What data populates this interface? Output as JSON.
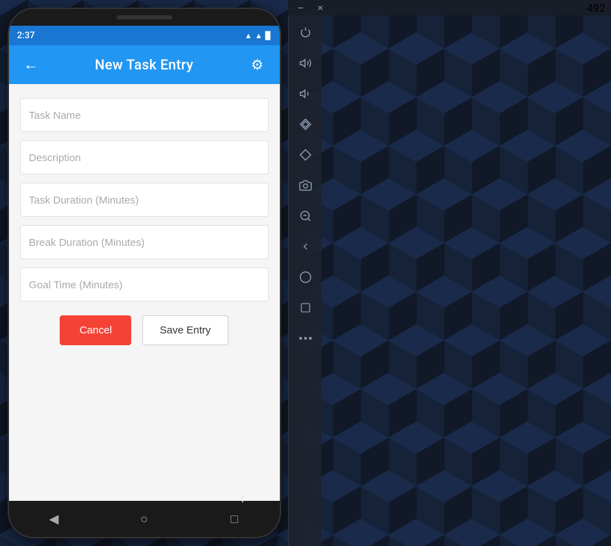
{
  "status_bar": {
    "time": "2:37",
    "icons": [
      "●",
      "▲",
      "▉"
    ]
  },
  "header": {
    "back_label": "←",
    "title": "New Task Entry",
    "settings_label": "⚙"
  },
  "form": {
    "fields": [
      {
        "placeholder": "Task Name",
        "value": ""
      },
      {
        "placeholder": "Description",
        "value": ""
      },
      {
        "placeholder": "Task Duration (Minutes)",
        "value": ""
      },
      {
        "placeholder": "Break Duration (Minutes)",
        "value": ""
      },
      {
        "placeholder": "Goal Time (Minutes)",
        "value": ""
      }
    ],
    "cancel_label": "Cancel",
    "save_label": "Save Entry"
  },
  "nav": {
    "back": "◀",
    "home": "○",
    "recents": "□"
  },
  "window": {
    "minimize": "−",
    "close": "×",
    "counter": "492"
  },
  "toolbar": {
    "items": [
      {
        "name": "power-icon",
        "glyph": "⏻"
      },
      {
        "name": "volume-up-icon",
        "glyph": "🔊"
      },
      {
        "name": "volume-down-icon",
        "glyph": "🔉"
      },
      {
        "name": "diamond1-icon",
        "glyph": "◈"
      },
      {
        "name": "diamond2-icon",
        "glyph": "◇"
      },
      {
        "name": "camera-icon",
        "glyph": "⊙"
      },
      {
        "name": "zoom-out-icon",
        "glyph": "⊖"
      },
      {
        "name": "back-icon",
        "glyph": "◁"
      },
      {
        "name": "circle-icon",
        "glyph": "○"
      },
      {
        "name": "square-icon",
        "glyph": "□"
      },
      {
        "name": "more-icon",
        "glyph": "•••"
      }
    ]
  }
}
